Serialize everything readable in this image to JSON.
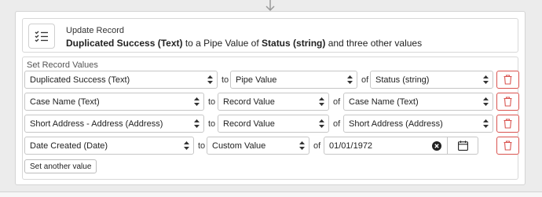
{
  "header": {
    "title": "Update Record",
    "summary_field": "Duplicated Success (Text)",
    "summary_mid": " to a Pipe Value of ",
    "summary_value": "Status (string)",
    "summary_tail": " and three other values"
  },
  "section": {
    "label": "Set Record Values",
    "add_button_label": "Set another value"
  },
  "rows": [
    {
      "field": "Duplicated Success (Text)",
      "to": "to",
      "source": "Pipe Value",
      "of": "of",
      "value": "Status (string)"
    },
    {
      "field": "Case Name (Text)",
      "to": "to",
      "source": "Record Value",
      "of": "of",
      "value": "Case Name (Text)"
    },
    {
      "field": "Short Address - Address (Address)",
      "to": "to",
      "source": "Record Value",
      "of": "of",
      "value": "Short Address (Address)"
    },
    {
      "field": "Date Created (Date)",
      "to": "to",
      "source": "Custom Value",
      "of": "of",
      "value": "01/01/1972"
    }
  ],
  "icons": {
    "header": "checklist-icon",
    "delete": "trash-icon",
    "clear": "clear-circle-icon",
    "calendar": "calendar-icon",
    "select": "select-caret-icon",
    "flow": "down-arrow-icon"
  },
  "colors": {
    "delete_red": "#d9534f",
    "border": "#c6c6c6"
  }
}
